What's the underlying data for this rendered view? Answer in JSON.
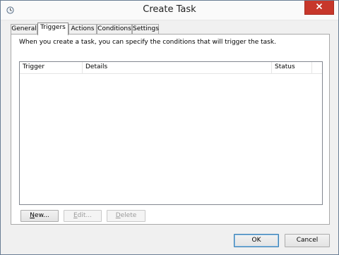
{
  "window": {
    "title": "Create Task"
  },
  "tabs": [
    {
      "label": "General"
    },
    {
      "label": "Triggers"
    },
    {
      "label": "Actions"
    },
    {
      "label": "Conditions"
    },
    {
      "label": "Settings"
    }
  ],
  "active_tab": "Triggers",
  "triggers_panel": {
    "description": "When you create a task, you can specify the conditions that will trigger the task.",
    "columns": [
      "Trigger",
      "Details",
      "Status"
    ],
    "rows": [],
    "buttons": {
      "new": {
        "mnemonic": "N",
        "rest": "ew...",
        "enabled": true
      },
      "edit": {
        "mnemonic": "E",
        "rest": "dit...",
        "enabled": false
      },
      "delete": {
        "mnemonic": "D",
        "rest": "elete",
        "enabled": false
      }
    }
  },
  "dialog_buttons": {
    "ok": "OK",
    "cancel": "Cancel"
  },
  "colors": {
    "close_button": "#c7372b",
    "window_border": "#6a7e94"
  }
}
